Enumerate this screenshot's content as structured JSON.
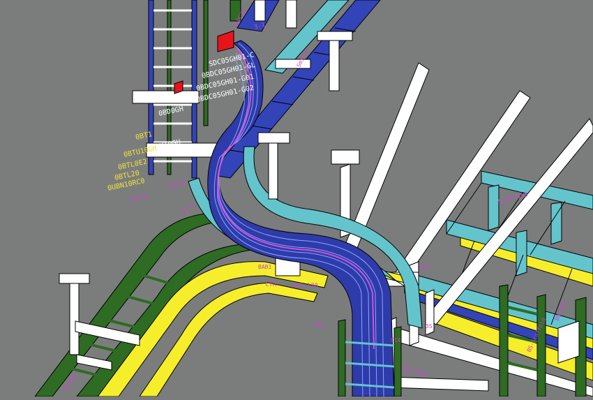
{
  "scene": {
    "type": "3D CAD cable tray routing view",
    "colors": {
      "background": "#7b7d7d",
      "tray_green": "#2e6b23",
      "tray_blue": "#3344b8",
      "tray_cyan": "#64c4cc",
      "tray_yellow": "#f6ee2a",
      "support_white": "#ffffff",
      "cable_bundle": "#2d3caa",
      "cable_line": "#d84fd2",
      "equipment_red": "#e8141c",
      "label_magenta": "#c548c8",
      "label_yellow": "#f0e236",
      "edge": "#000000"
    }
  },
  "labels": {
    "tl_magenta_1": "3-1",
    "tl_magenta_2": "SAQC25",
    "tl_white_1": "SDC05GH01-C",
    "tl_white_2": "0BDC05GH01-GL",
    "tl_white_3": "0BDC05GH01-G01",
    "tl_white_4": "0BDC05GH01-G02",
    "tl_white_5": "0BD0GH",
    "tl_white_6": "0BU10GH",
    "y_1": "0BT1",
    "y_2": "0BTU10GH",
    "y_3": "0BTL0E2",
    "y_4": "0BTL20",
    "y_5": "0UBN10RC0",
    "m_1": "1S2TR",
    "m_2": "1S2TR",
    "m_3": "CTA",
    "m_4": "1S2-170",
    "m_5": "1S2",
    "m_6": "2S2",
    "m_7": "Scaffold",
    "m_8": "1S2-BAF",
    "m_9": "BS-Scaffold",
    "m_10": "BU7000",
    "m_11": "BAB1",
    "m_12": "Smithy",
    "m_13": "C14",
    "m_14": "3S",
    "m_15": "1S2-B",
    "m_16": "BU7000"
  }
}
